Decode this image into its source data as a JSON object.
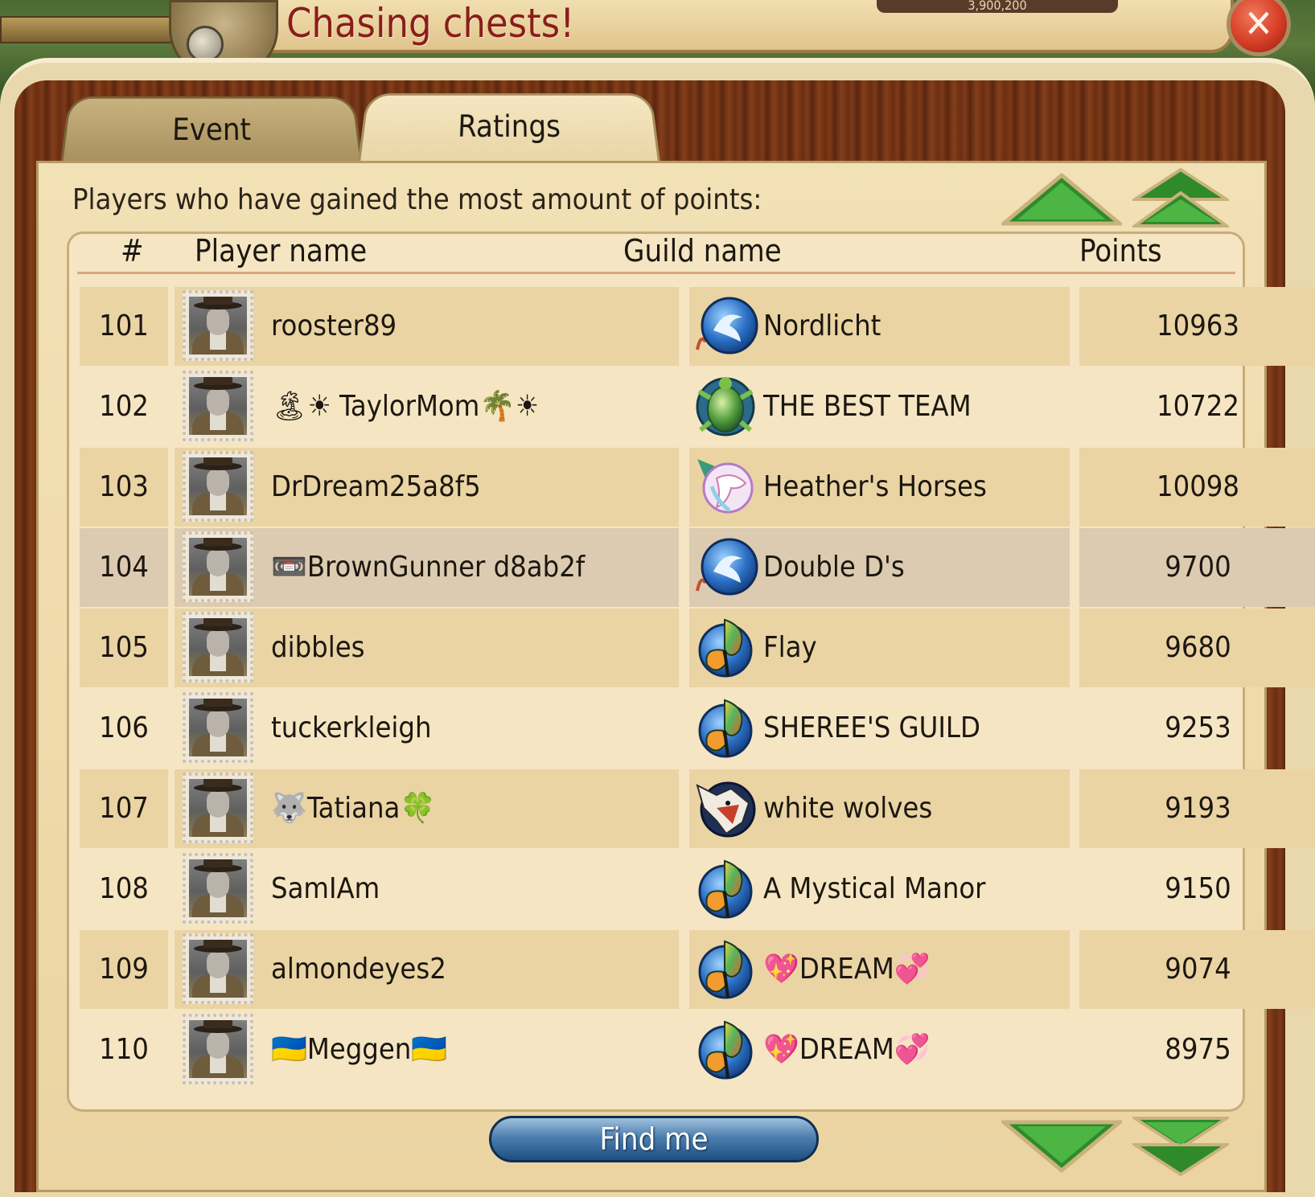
{
  "window": {
    "title": "Chasing chests!",
    "top_readout": "3,900,200",
    "close_label": "✕"
  },
  "tabs": [
    {
      "label": "Event",
      "active": false
    },
    {
      "label": "Ratings",
      "active": true
    }
  ],
  "subtitle": "Players who have gained the most amount of points:",
  "columns": {
    "rank": "#",
    "player": "Player name",
    "guild": "Guild name",
    "points": "Points"
  },
  "rows": [
    {
      "rank": "101",
      "player": "rooster89",
      "guild": "Nordlicht",
      "guild_icon": "dolphin-coral-icon",
      "points": "10963"
    },
    {
      "rank": "102",
      "player": "🏝☀ TaylorMom🌴☀",
      "guild": "THE BEST TEAM",
      "guild_icon": "turtle-icon",
      "points": "10722"
    },
    {
      "rank": "103",
      "player": "DrDream25a8f5",
      "guild": "Heather's Horses",
      "guild_icon": "unicorn-icon",
      "points": "10098"
    },
    {
      "rank": "104",
      "player": "📼BrownGunner d8ab2f",
      "guild": "Double D's",
      "guild_icon": "dolphin-coral-icon",
      "points": "9700",
      "highlight": true
    },
    {
      "rank": "105",
      "player": "dibbles",
      "guild": "Flay",
      "guild_icon": "butterfly-icon",
      "points": "9680"
    },
    {
      "rank": "106",
      "player": "tuckerkleigh",
      "guild": "SHEREE'S GUILD",
      "guild_icon": "butterfly-icon",
      "points": "9253"
    },
    {
      "rank": "107",
      "player": "🐺Tatiana🍀",
      "guild": "white wolves",
      "guild_icon": "wolf-icon",
      "points": "9193"
    },
    {
      "rank": "108",
      "player": "SamIAm",
      "guild": "A Mystical Manor",
      "guild_icon": "butterfly-icon",
      "points": "9150"
    },
    {
      "rank": "109",
      "player": "almondeyes2",
      "guild": "💖DREAM💞",
      "guild_icon": "butterfly-icon",
      "points": "9074"
    },
    {
      "rank": "110",
      "player": "🇺🇦Meggen🇺🇦",
      "guild": "💖DREAM💞",
      "guild_icon": "butterfly-icon",
      "points": "8975"
    }
  ],
  "find_me_label": "Find me",
  "nav": {
    "up": "arrow-up-icon",
    "top": "double-arrow-up-icon",
    "down": "arrow-down-icon",
    "bottom": "double-arrow-down-icon"
  },
  "colors": {
    "title": "#8a1e1a",
    "highlight_row": "#dccbb0",
    "arrow_green": "#2f8a2a",
    "button_blue": "#1f4f82"
  }
}
